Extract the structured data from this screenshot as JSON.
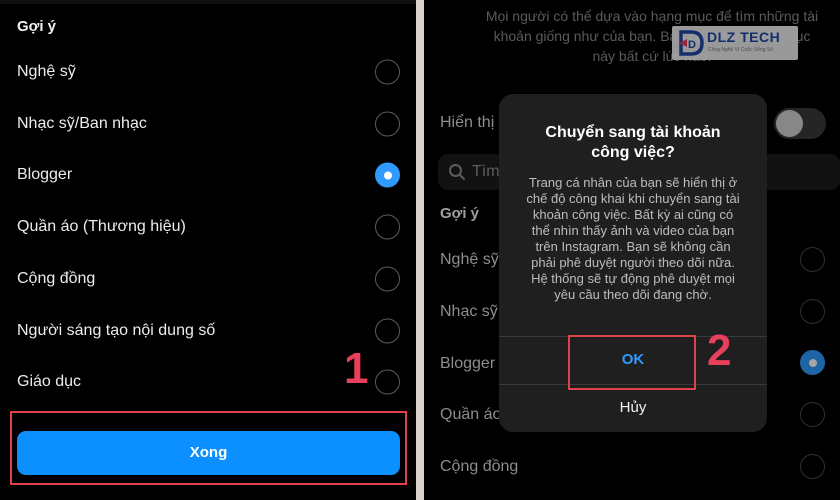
{
  "left": {
    "section_title": "Gợi ý",
    "options": [
      {
        "label": "Nghệ sỹ",
        "selected": false
      },
      {
        "label": "Nhạc sỹ/Ban nhạc",
        "selected": false
      },
      {
        "label": "Blogger",
        "selected": true
      },
      {
        "label": "Quần áo (Thương hiệu)",
        "selected": false
      },
      {
        "label": "Cộng đồng",
        "selected": false
      },
      {
        "label": "Người sáng tạo nội dung số",
        "selected": false
      },
      {
        "label": "Giáo dục",
        "selected": false
      }
    ],
    "done_label": "Xong",
    "step_number": "1"
  },
  "right": {
    "background_desc_lines": [
      "Mọi người có thể dựa vào hạng mục để tìm những tài",
      "khoản giống như của bạn. Bạn có thể thay đổi mục",
      "này bất cứ lúc nào."
    ],
    "toggle_label": "Hiển thị",
    "search_placeholder": "Tìm",
    "section_title": "Gợi ý",
    "options": [
      {
        "label": "Nghệ sỹ",
        "selected": false
      },
      {
        "label": "Nhạc sỹ",
        "selected": false
      },
      {
        "label": "Blogger",
        "selected": true
      },
      {
        "label": "Quần áo",
        "selected": false
      },
      {
        "label": "Cộng đồng",
        "selected": false
      }
    ],
    "dialog": {
      "title_line1": "Chuyển sang tài khoản",
      "title_line2": "công việc?",
      "message_lines": [
        "Trang cá nhân của bạn sẽ hiển thị ở",
        "chế độ công khai khi chuyển sang tài",
        "khoản công việc. Bất kỳ ai cũng có",
        "thể nhìn thấy ảnh và video của bạn",
        "trên Instagram. Bạn sẽ không cần",
        "phải phê duyệt người theo dõi nữa.",
        "Hệ thống sẽ tự động phê duyệt mọi",
        "yêu cầu theo dõi đang chờ."
      ],
      "ok_label": "OK",
      "cancel_label": "Hủy"
    },
    "step_number": "2",
    "logo": {
      "name": "DLZ TECH",
      "tagline": "Công Nghệ Vì Cuộc Sống Số"
    }
  },
  "colors": {
    "accent_blue": "#0c8fff",
    "link_blue": "#2f9bff",
    "annotation_red": "#e0424a",
    "step_number_pink": "#e8405c"
  },
  "icons": {
    "search": "search-icon",
    "radio_selected": "radio-selected-icon",
    "radio_empty": "radio-empty-icon",
    "logo": "dlz-logo-icon"
  }
}
